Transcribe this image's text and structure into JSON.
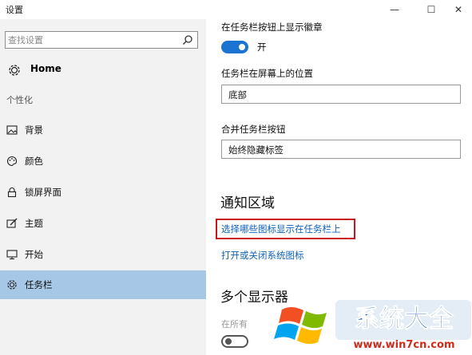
{
  "window": {
    "title": "设置",
    "controls": {
      "minimize": "—",
      "maximize": "☐",
      "close": "✕"
    }
  },
  "sidebar": {
    "search_placeholder": "查找设置",
    "home_label": "Home",
    "section_label": "个性化",
    "items": [
      {
        "label": "背景",
        "icon": "image-icon"
      },
      {
        "label": "颜色",
        "icon": "palette-icon"
      },
      {
        "label": "锁屏界面",
        "icon": "lock-icon"
      },
      {
        "label": "主题",
        "icon": "brush-icon"
      },
      {
        "label": "开始",
        "icon": "start-icon"
      },
      {
        "label": "任务栏",
        "icon": "gear-icon",
        "selected": true
      }
    ]
  },
  "content": {
    "badge_setting_label": "在任务栏按钮上显示徽章",
    "badge_toggle_state": "开",
    "position_label": "任务栏在屏幕上的位置",
    "position_value": "底部",
    "combine_label": "合并任务栏按钮",
    "combine_value": "始终隐藏标签",
    "notification_heading": "通知区域",
    "notification_link_1": "选择哪些图标显示在任务栏上",
    "notification_link_2": "打开或关闭系统图标",
    "multi_display_heading": "多个显示器",
    "multi_display_partial": "在所有"
  },
  "watermark": {
    "text_main": "系统大全",
    "text_url": "www.win7cn.com"
  },
  "colors": {
    "accent": "#1b74d0",
    "selected_bg": "#a6c8e6",
    "sidebar_bg": "#f2f2f2",
    "link": "#0e63b8",
    "highlight_border": "#c8161d"
  }
}
